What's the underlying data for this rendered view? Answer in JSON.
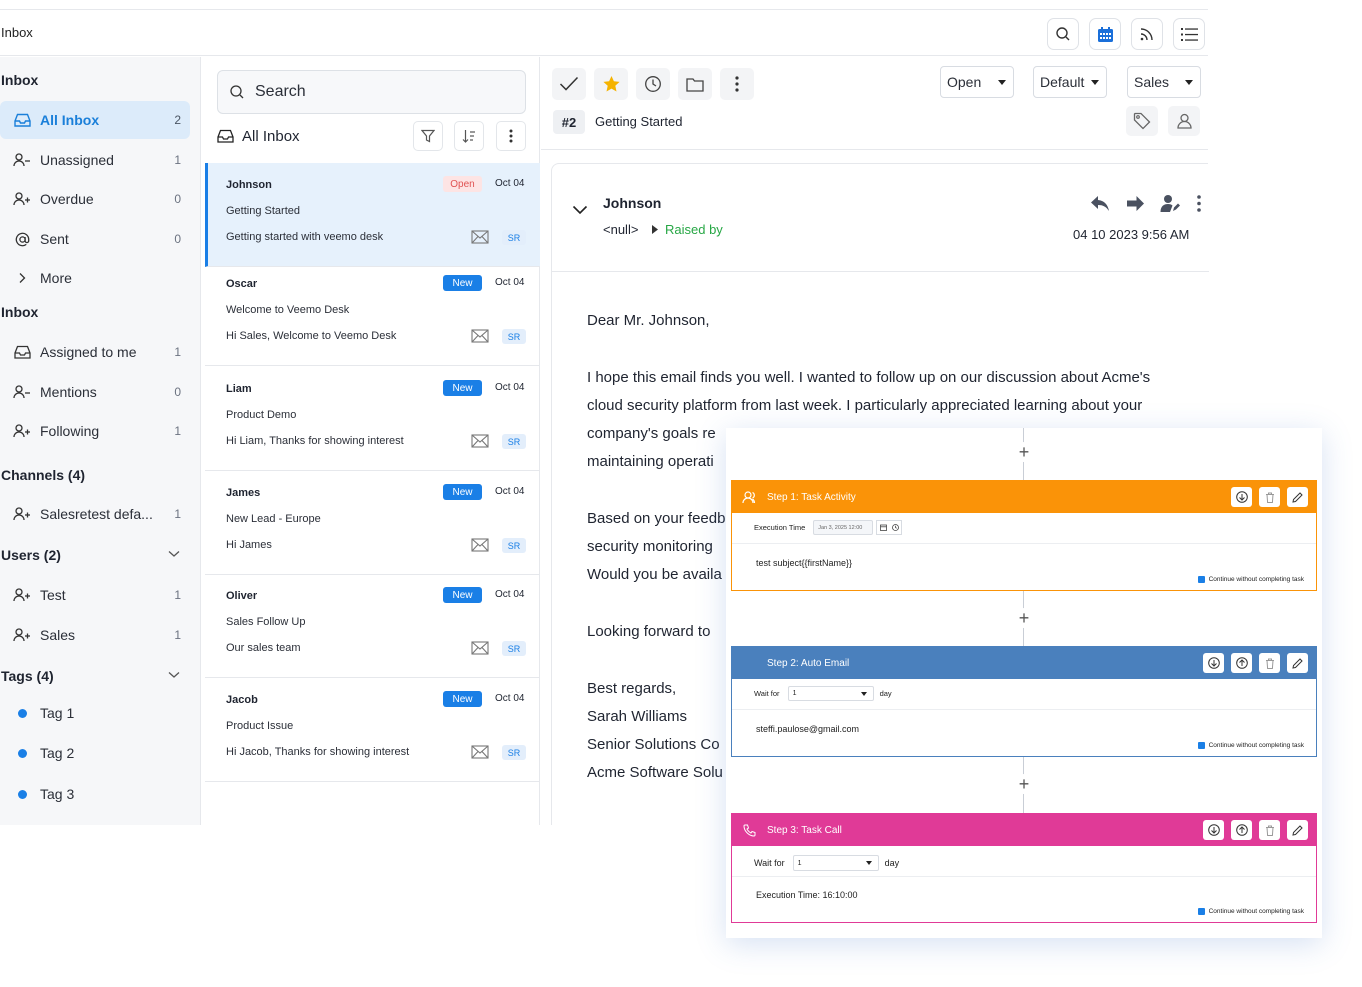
{
  "topbar": {
    "title": "Inbox",
    "icons": [
      "search-icon",
      "calendar-icon",
      "feed-icon",
      "list-icon"
    ]
  },
  "sidebar": {
    "inbox_heading": "Inbox",
    "items_top": [
      {
        "label": "All Inbox",
        "count": "2",
        "icon": "inbox-icon",
        "active": true
      },
      {
        "label": "Unassigned",
        "count": "1",
        "icon": "user-minus-icon"
      },
      {
        "label": "Overdue",
        "count": "0",
        "icon": "user-plus-icon"
      },
      {
        "label": "Sent",
        "count": "0",
        "icon": "at-icon"
      },
      {
        "label": "More",
        "count": "",
        "icon": "chevron-right-icon"
      }
    ],
    "inbox_heading2": "Inbox",
    "items_inbox": [
      {
        "label": "Assigned to me",
        "count": "1",
        "icon": "inbox-icon"
      },
      {
        "label": "Mentions",
        "count": "0",
        "icon": "user-minus-icon"
      },
      {
        "label": "Following",
        "count": "1",
        "icon": "user-plus-icon"
      }
    ],
    "channels_heading": "Channels (4)",
    "channels": [
      {
        "label": "Salesretest defa...",
        "count": "1"
      }
    ],
    "users_heading": "Users (2)",
    "users": [
      {
        "label": "Test",
        "count": "1"
      },
      {
        "label": "Sales",
        "count": "1"
      }
    ],
    "tags_heading": "Tags (4)",
    "tags": [
      {
        "label": "Tag 1",
        "color": "#1a7fe6"
      },
      {
        "label": "Tag 2",
        "color": "#1a7fe6"
      },
      {
        "label": "Tag 3",
        "color": "#1a7fe6"
      }
    ]
  },
  "list": {
    "search_placeholder": "Search",
    "heading": "All Inbox",
    "conversations": [
      {
        "name": "Johnson",
        "status": "Open",
        "date": "Oct 04",
        "subject": "Getting Started",
        "preview": "Getting started with veemo desk",
        "tag": "SR"
      },
      {
        "name": "Oscar",
        "status": "New",
        "date": "Oct 04",
        "subject": "Welcome to Veemo Desk",
        "preview": "Hi Sales, Welcome to Veemo Desk",
        "tag": "SR"
      },
      {
        "name": "Liam",
        "status": "New",
        "date": "Oct 04",
        "subject": "Product Demo",
        "preview": "Hi Liam, Thanks for showing interest",
        "tag": "SR"
      },
      {
        "name": "James",
        "status": "New",
        "date": "Oct 04",
        "subject": "New Lead - Europe",
        "preview": "Hi James",
        "tag": "SR"
      },
      {
        "name": "Oliver",
        "status": "New",
        "date": "Oct 04",
        "subject": "Sales Follow Up",
        "preview": "Our sales team",
        "tag": "SR"
      },
      {
        "name": "Jacob",
        "status": "New",
        "date": "Oct 04",
        "subject": "Product Issue",
        "preview": "Hi Jacob, Thanks for showing interest",
        "tag": "SR"
      }
    ]
  },
  "detail": {
    "status_select": "Open",
    "priority_select": "Default",
    "team_select": "Sales",
    "ticket_no": "#2",
    "ticket_title": "Getting Started",
    "sender": "Johnson",
    "sender_email": "<null>",
    "raised_by": "Raised by",
    "timestamp": "04 10 2023 9:56 AM",
    "body": [
      "Dear Mr. Johnson,",
      "I hope this email finds you well. I wanted to follow up on our discussion about Acme's",
      "cloud security platform from last week. I particularly appreciated learning about your",
      "company's goals re",
      "maintaining operati",
      "Based on your feedb",
      "security monitoring",
      "Would you be availa",
      "Looking forward to",
      "Best regards,",
      "Sarah Williams",
      "Senior Solutions Co",
      "Acme Software Solu"
    ]
  },
  "workflow": {
    "steps": [
      {
        "title": "Step 1: Task Activity",
        "color": "#fa9308",
        "row_label": "Execution Time",
        "row_value": "Jan 3, 2025 12:00",
        "text": "test subject{{firstName}}",
        "checkbox": "Continue without completing task"
      },
      {
        "title": "Step 2: Auto Email",
        "color": "#4a80bd",
        "row_label": "Wait for",
        "row_value": "1",
        "row_unit": "day",
        "text": "steffi.paulose@gmail.com",
        "checkbox": "Continue without completing task"
      },
      {
        "title": "Step 3: Task Call",
        "color": "#e03a97",
        "row_label": "Wait for",
        "row_value": "1",
        "row_unit": "day",
        "text": "Execution Time: 16:10:00",
        "checkbox": "Continue without completing task"
      }
    ],
    "add_symbol": "+"
  }
}
